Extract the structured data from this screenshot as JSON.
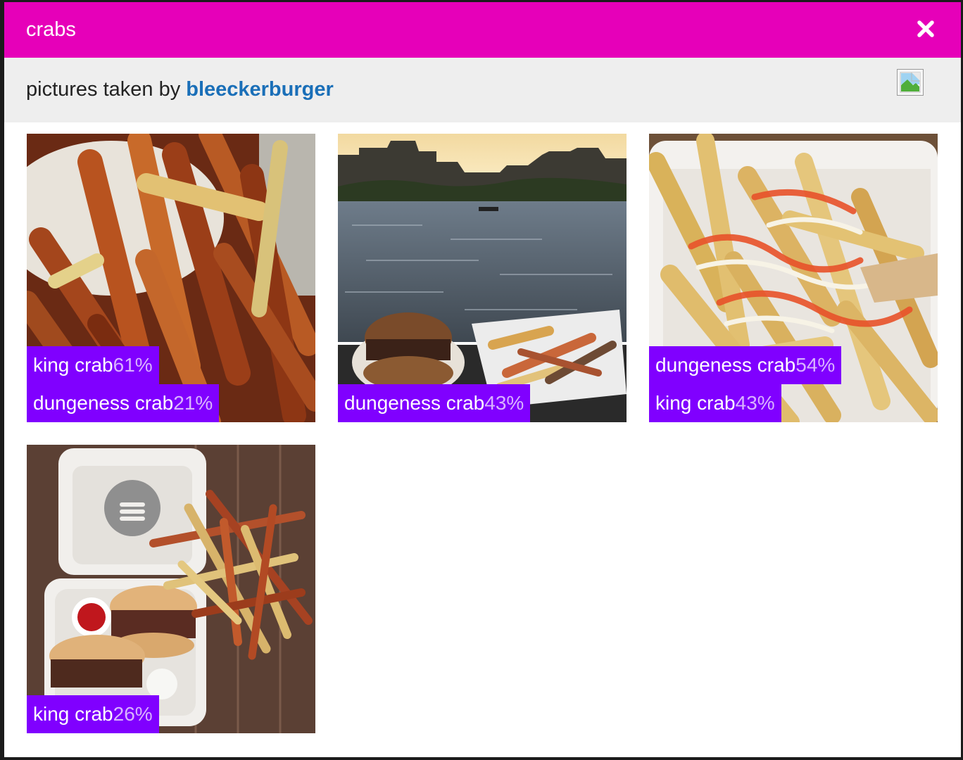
{
  "modal": {
    "title": "crabs"
  },
  "subheader": {
    "prefix": "pictures taken by",
    "username": "bleeckerburger"
  },
  "icons": {
    "close": "close-icon",
    "avatar": "broken-image-icon"
  },
  "colors": {
    "titlebar": "#e600b9",
    "tag_background": "#8000ff",
    "username_link": "#1a6fb8",
    "subheader_background": "#eeeeee"
  },
  "photos": [
    {
      "tags": [
        {
          "label": "king crab",
          "percent": "61%"
        },
        {
          "label": "dungeness crab",
          "percent": "21%"
        }
      ]
    },
    {
      "tags": [
        {
          "label": "dungeness crab",
          "percent": "43%"
        }
      ]
    },
    {
      "tags": [
        {
          "label": "dungeness crab",
          "percent": "54%"
        },
        {
          "label": "king crab",
          "percent": "43%"
        }
      ]
    },
    {
      "tags": [
        {
          "label": "king crab",
          "percent": "26%"
        }
      ]
    }
  ]
}
